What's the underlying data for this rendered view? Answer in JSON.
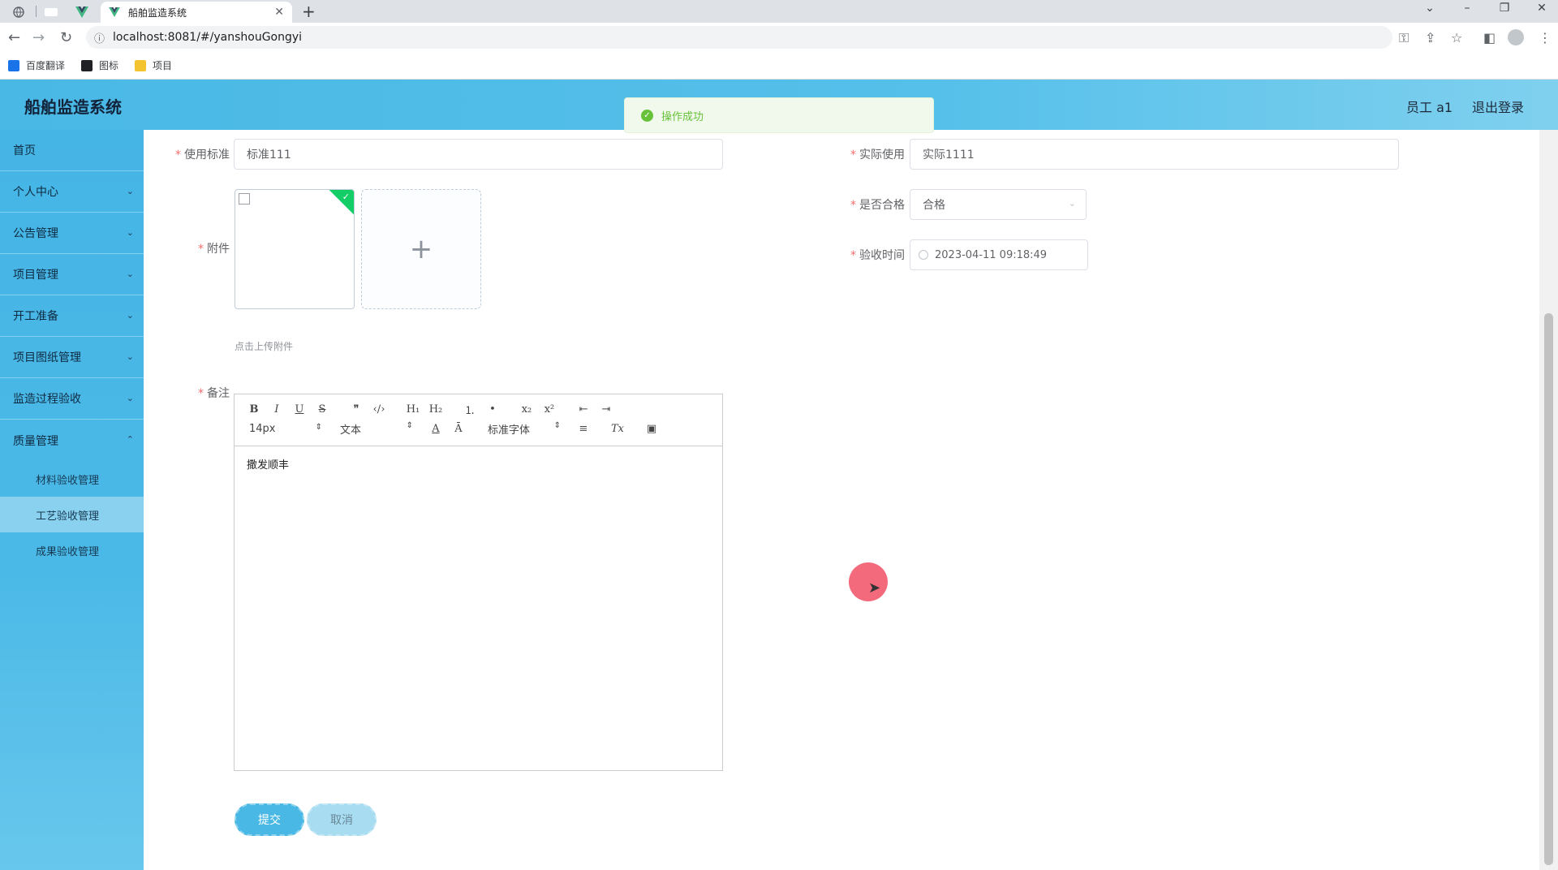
{
  "browser": {
    "tab_title": "船舶监造系统",
    "tab_close": "✕",
    "new_tab": "+",
    "url": "localhost:8081/#/yanshouGongyi",
    "bookmarks": [
      {
        "label": "百度翻译",
        "color": "#1a73e8"
      },
      {
        "label": "图标",
        "color": "#202124"
      },
      {
        "label": "项目",
        "color": "#f4c430"
      }
    ]
  },
  "header": {
    "title": "船舶监造系统",
    "user": "员工 a1",
    "logout": "退出登录"
  },
  "toast": {
    "message": "操作成功",
    "icon": "check-circle-icon"
  },
  "sidebar": {
    "items": [
      {
        "label": "首页"
      },
      {
        "label": "个人中心"
      },
      {
        "label": "公告管理"
      },
      {
        "label": "项目管理"
      },
      {
        "label": "开工准备"
      },
      {
        "label": "项目图纸管理"
      },
      {
        "label": "监造过程验收"
      },
      {
        "label": "质量管理"
      }
    ],
    "sub_items": [
      {
        "label": "材料验收管理"
      },
      {
        "label": "工艺验收管理"
      },
      {
        "label": "成果验收管理"
      }
    ]
  },
  "form": {
    "standard_label": "使用标准",
    "standard_value": "标准111",
    "actual_label": "实际使用",
    "actual_value": "实际1111",
    "attachment_label": "附件",
    "qualified_label": "是否合格",
    "qualified_value": "合格",
    "time_label": "验收时间",
    "time_value": "2023-04-11 09:18:49",
    "upload_tip": "点击上传附件",
    "remark_label": "备注",
    "remark_value": "撒发顺丰",
    "submit": "提交",
    "cancel": "取消"
  },
  "editor_toolbar": {
    "row1": [
      "B",
      "I",
      "U",
      "S",
      "❞",
      "‹/›",
      "H₁",
      "H₂",
      "⒈",
      "•",
      "x₂",
      "x²",
      "⇤",
      "⇥"
    ],
    "size": "14px",
    "block": "文本",
    "font": "标准字体",
    "color_btn": "A",
    "bg_btn": "Ā",
    "align_btn": "≡",
    "clear_btn": "Tx",
    "image_btn": "▣"
  }
}
